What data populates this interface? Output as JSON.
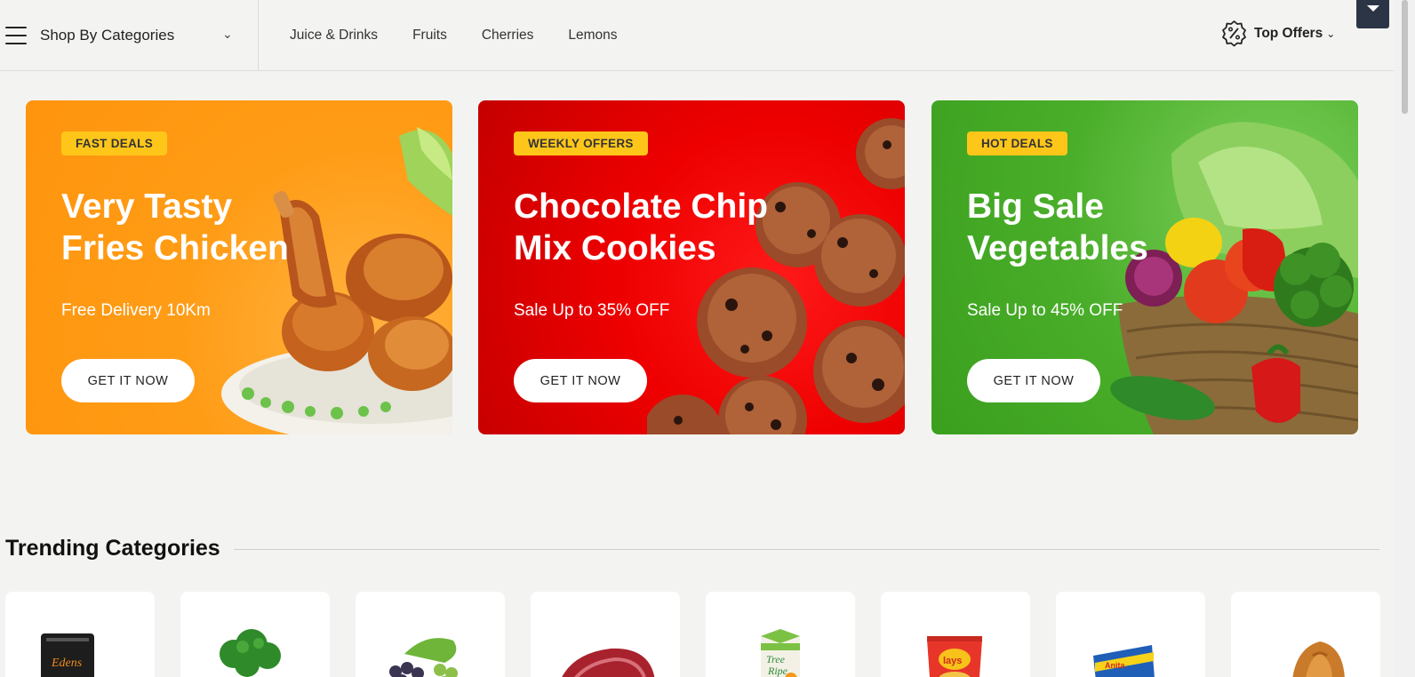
{
  "nav": {
    "category_label": "Shop By Categories",
    "links": [
      "Juice & Drinks",
      "Fruits",
      "Cherries",
      "Lemons"
    ],
    "offers_label": "Top Offers",
    "offers_icon": "percent-badge-icon"
  },
  "banners": [
    {
      "tag": "FAST DEALS",
      "title_1": "Very Tasty",
      "title_2": "Fries Chicken",
      "subtitle": "Free Delivery 10Km",
      "button": "GET IT NOW",
      "color": "#ff9c16"
    },
    {
      "tag": "WEEKLY OFFERS",
      "title_1": "Chocolate Chip",
      "title_2": "Mix Cookies",
      "subtitle": "Sale Up to 35% OFF",
      "button": "GET IT NOW",
      "color": "#e00000"
    },
    {
      "tag": "HOT DEALS",
      "title_1": "Big Sale",
      "title_2": "Vegetables",
      "subtitle": "Sale Up to 45% OFF",
      "button": "GET IT NOW",
      "color": "#4aae2a"
    }
  ],
  "trending": {
    "title": "Trending Categories",
    "items": [
      "edens-bag-image",
      "broccoli-image",
      "grapes-image",
      "meat-image",
      "juice-carton-image",
      "lays-chips-image",
      "blue-box-image",
      "croissant-image"
    ]
  },
  "colors": {
    "tag": "#ffc61a",
    "dark": "#2c3546"
  }
}
